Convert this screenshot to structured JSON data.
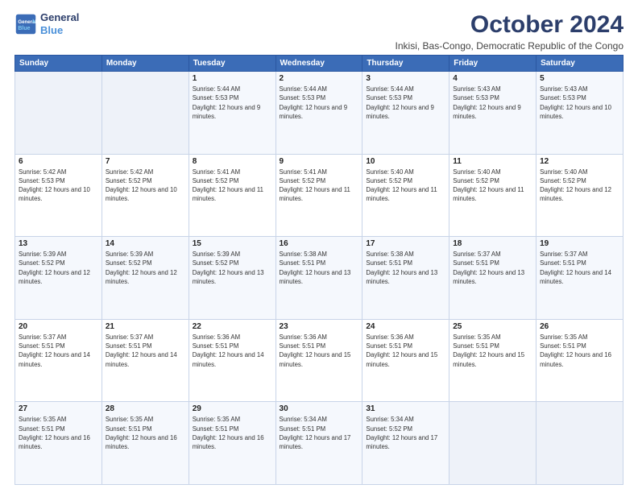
{
  "logo": {
    "line1": "General",
    "line2": "Blue"
  },
  "header": {
    "month_year": "October 2024",
    "location": "Inkisi, Bas-Congo, Democratic Republic of the Congo"
  },
  "days_of_week": [
    "Sunday",
    "Monday",
    "Tuesday",
    "Wednesday",
    "Thursday",
    "Friday",
    "Saturday"
  ],
  "weeks": [
    [
      {
        "day": "",
        "info": ""
      },
      {
        "day": "",
        "info": ""
      },
      {
        "day": "1",
        "info": "Sunrise: 5:44 AM\nSunset: 5:53 PM\nDaylight: 12 hours and 9 minutes."
      },
      {
        "day": "2",
        "info": "Sunrise: 5:44 AM\nSunset: 5:53 PM\nDaylight: 12 hours and 9 minutes."
      },
      {
        "day": "3",
        "info": "Sunrise: 5:44 AM\nSunset: 5:53 PM\nDaylight: 12 hours and 9 minutes."
      },
      {
        "day": "4",
        "info": "Sunrise: 5:43 AM\nSunset: 5:53 PM\nDaylight: 12 hours and 9 minutes."
      },
      {
        "day": "5",
        "info": "Sunrise: 5:43 AM\nSunset: 5:53 PM\nDaylight: 12 hours and 10 minutes."
      }
    ],
    [
      {
        "day": "6",
        "info": "Sunrise: 5:42 AM\nSunset: 5:53 PM\nDaylight: 12 hours and 10 minutes."
      },
      {
        "day": "7",
        "info": "Sunrise: 5:42 AM\nSunset: 5:52 PM\nDaylight: 12 hours and 10 minutes."
      },
      {
        "day": "8",
        "info": "Sunrise: 5:41 AM\nSunset: 5:52 PM\nDaylight: 12 hours and 11 minutes."
      },
      {
        "day": "9",
        "info": "Sunrise: 5:41 AM\nSunset: 5:52 PM\nDaylight: 12 hours and 11 minutes."
      },
      {
        "day": "10",
        "info": "Sunrise: 5:40 AM\nSunset: 5:52 PM\nDaylight: 12 hours and 11 minutes."
      },
      {
        "day": "11",
        "info": "Sunrise: 5:40 AM\nSunset: 5:52 PM\nDaylight: 12 hours and 11 minutes."
      },
      {
        "day": "12",
        "info": "Sunrise: 5:40 AM\nSunset: 5:52 PM\nDaylight: 12 hours and 12 minutes."
      }
    ],
    [
      {
        "day": "13",
        "info": "Sunrise: 5:39 AM\nSunset: 5:52 PM\nDaylight: 12 hours and 12 minutes."
      },
      {
        "day": "14",
        "info": "Sunrise: 5:39 AM\nSunset: 5:52 PM\nDaylight: 12 hours and 12 minutes."
      },
      {
        "day": "15",
        "info": "Sunrise: 5:39 AM\nSunset: 5:52 PM\nDaylight: 12 hours and 13 minutes."
      },
      {
        "day": "16",
        "info": "Sunrise: 5:38 AM\nSunset: 5:51 PM\nDaylight: 12 hours and 13 minutes."
      },
      {
        "day": "17",
        "info": "Sunrise: 5:38 AM\nSunset: 5:51 PM\nDaylight: 12 hours and 13 minutes."
      },
      {
        "day": "18",
        "info": "Sunrise: 5:37 AM\nSunset: 5:51 PM\nDaylight: 12 hours and 13 minutes."
      },
      {
        "day": "19",
        "info": "Sunrise: 5:37 AM\nSunset: 5:51 PM\nDaylight: 12 hours and 14 minutes."
      }
    ],
    [
      {
        "day": "20",
        "info": "Sunrise: 5:37 AM\nSunset: 5:51 PM\nDaylight: 12 hours and 14 minutes."
      },
      {
        "day": "21",
        "info": "Sunrise: 5:37 AM\nSunset: 5:51 PM\nDaylight: 12 hours and 14 minutes."
      },
      {
        "day": "22",
        "info": "Sunrise: 5:36 AM\nSunset: 5:51 PM\nDaylight: 12 hours and 14 minutes."
      },
      {
        "day": "23",
        "info": "Sunrise: 5:36 AM\nSunset: 5:51 PM\nDaylight: 12 hours and 15 minutes."
      },
      {
        "day": "24",
        "info": "Sunrise: 5:36 AM\nSunset: 5:51 PM\nDaylight: 12 hours and 15 minutes."
      },
      {
        "day": "25",
        "info": "Sunrise: 5:35 AM\nSunset: 5:51 PM\nDaylight: 12 hours and 15 minutes."
      },
      {
        "day": "26",
        "info": "Sunrise: 5:35 AM\nSunset: 5:51 PM\nDaylight: 12 hours and 16 minutes."
      }
    ],
    [
      {
        "day": "27",
        "info": "Sunrise: 5:35 AM\nSunset: 5:51 PM\nDaylight: 12 hours and 16 minutes."
      },
      {
        "day": "28",
        "info": "Sunrise: 5:35 AM\nSunset: 5:51 PM\nDaylight: 12 hours and 16 minutes."
      },
      {
        "day": "29",
        "info": "Sunrise: 5:35 AM\nSunset: 5:51 PM\nDaylight: 12 hours and 16 minutes."
      },
      {
        "day": "30",
        "info": "Sunrise: 5:34 AM\nSunset: 5:51 PM\nDaylight: 12 hours and 17 minutes."
      },
      {
        "day": "31",
        "info": "Sunrise: 5:34 AM\nSunset: 5:52 PM\nDaylight: 12 hours and 17 minutes."
      },
      {
        "day": "",
        "info": ""
      },
      {
        "day": "",
        "info": ""
      }
    ]
  ]
}
